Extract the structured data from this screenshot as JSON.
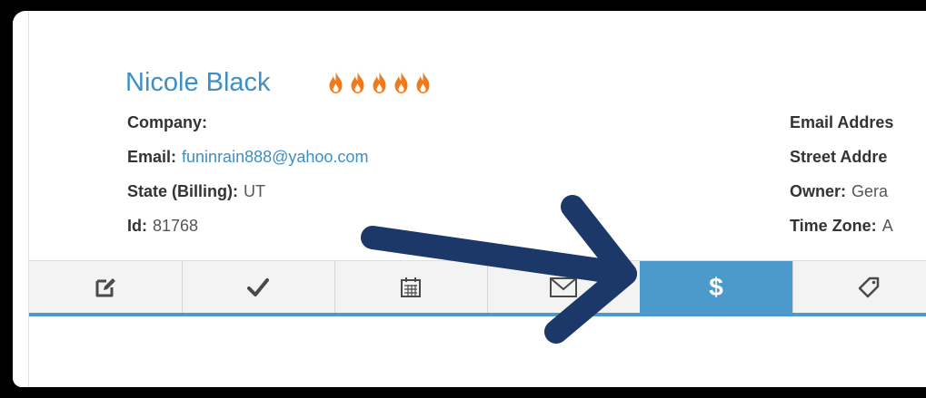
{
  "contact": {
    "name": "Nicole Black",
    "rating": 5,
    "rating_icon": "fire-icon"
  },
  "fields_left": [
    {
      "label": "Company:",
      "value": ""
    },
    {
      "label": "Email:",
      "value": "funinrain888@yahoo.com"
    },
    {
      "label": "State (Billing):",
      "value": "UT"
    },
    {
      "label": "Id:",
      "value": "81768"
    }
  ],
  "fields_right": [
    {
      "label": "Email Addres",
      "value": ""
    },
    {
      "label": "Street Addre",
      "value": ""
    },
    {
      "label": "Owner:",
      "value": "Gera"
    },
    {
      "label": "Time Zone:",
      "value": "A"
    }
  ],
  "tabs": [
    {
      "icon": "edit-note-icon",
      "active": false
    },
    {
      "icon": "checkmark-icon",
      "active": false
    },
    {
      "icon": "calendar-icon",
      "active": false
    },
    {
      "icon": "envelope-icon",
      "active": false
    },
    {
      "icon": "dollar-icon",
      "label": "$",
      "active": true
    },
    {
      "icon": "tag-icon",
      "active": false
    }
  ],
  "colors": {
    "link": "#3d8fc6",
    "active_tab": "#4b9acb",
    "flame": "#f07a1e",
    "arrow": "#1b3869"
  },
  "annotation": {
    "icon": "pointer-arrow-icon"
  }
}
